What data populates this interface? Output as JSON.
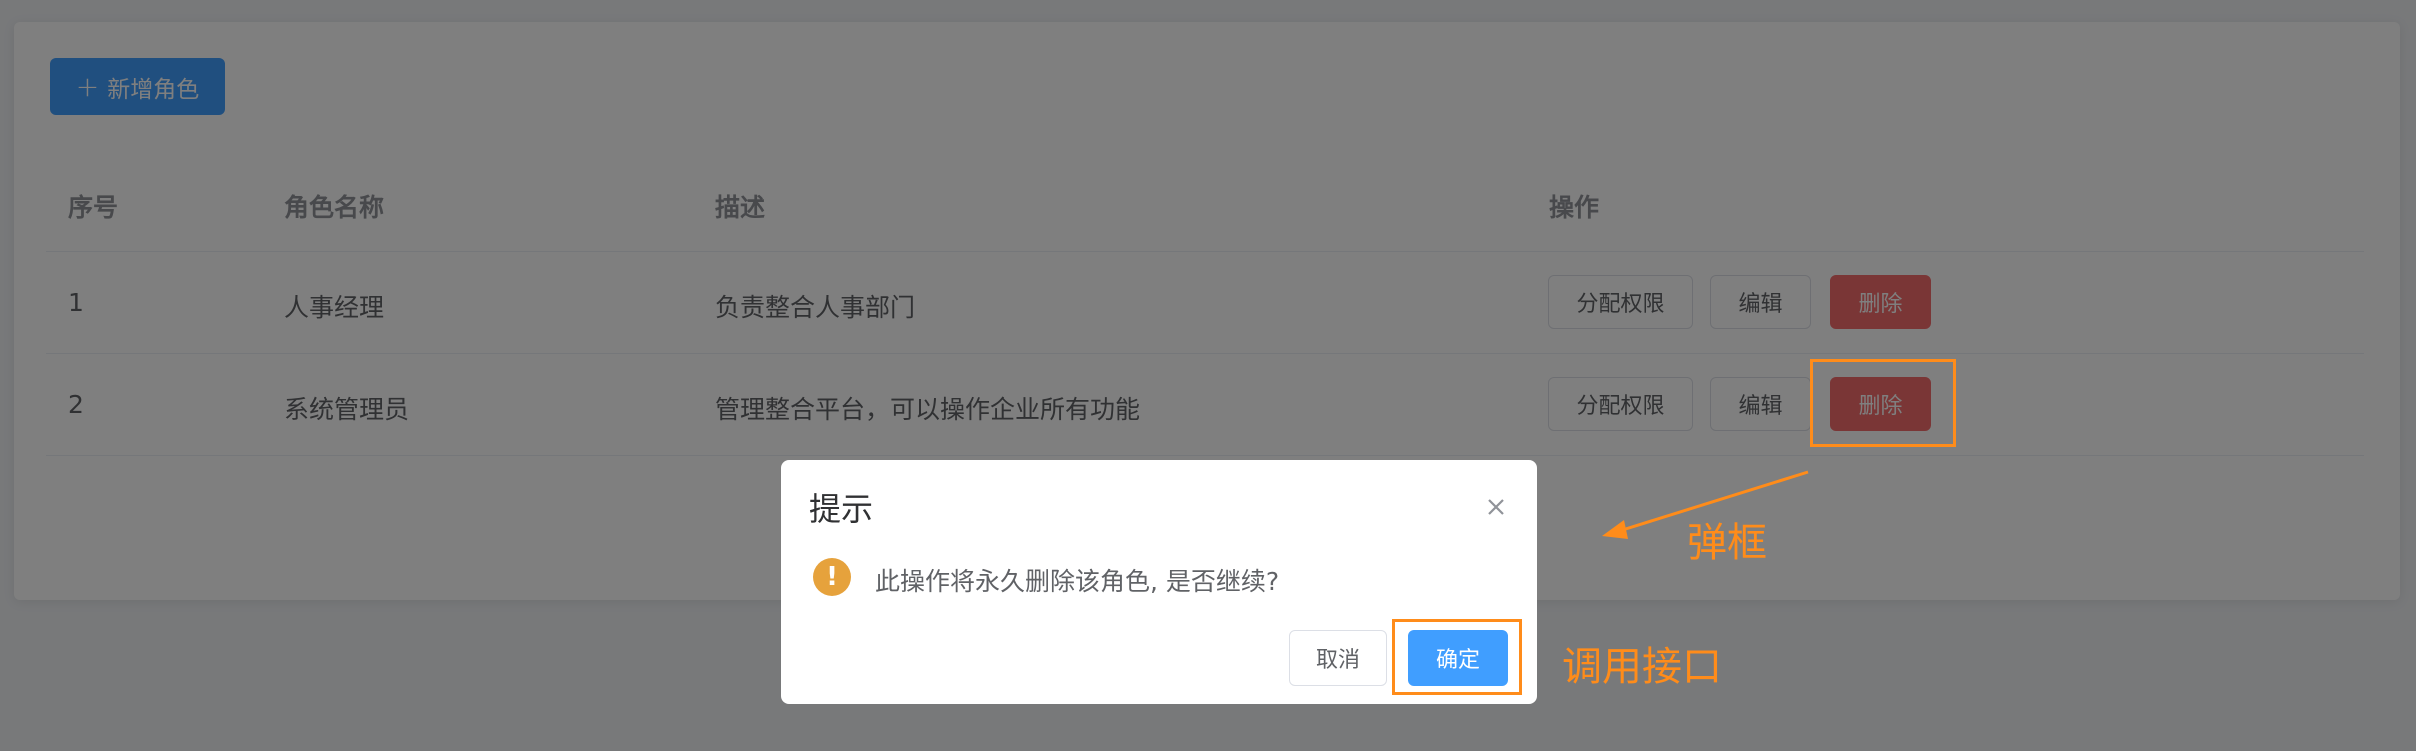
{
  "toolbar": {
    "add_label": "新增角色",
    "add_icon": "plus-icon"
  },
  "table": {
    "headers": [
      "序号",
      "角色名称",
      "描述",
      "操作"
    ],
    "rows": [
      {
        "index": "1",
        "name": "人事经理",
        "desc": "负责整合人事部门"
      },
      {
        "index": "2",
        "name": "系统管理员",
        "desc": "管理整合平台，可以操作企业所有功能"
      }
    ],
    "actions": {
      "assign": "分配权限",
      "edit": "编辑",
      "delete": "删除"
    }
  },
  "dialog": {
    "title": "提示",
    "message": "此操作将永久删除该角色, 是否继续?",
    "warn_icon": "warning-icon",
    "close_icon": "close-icon",
    "cancel": "取消",
    "confirm": "确定"
  },
  "annotations": {
    "popup": "弹框",
    "call_api": "调用接口"
  },
  "colors": {
    "primary": "#409eff",
    "danger": "#f56c6c",
    "warning": "#e6a23c",
    "annotation": "#ff8c1a"
  }
}
